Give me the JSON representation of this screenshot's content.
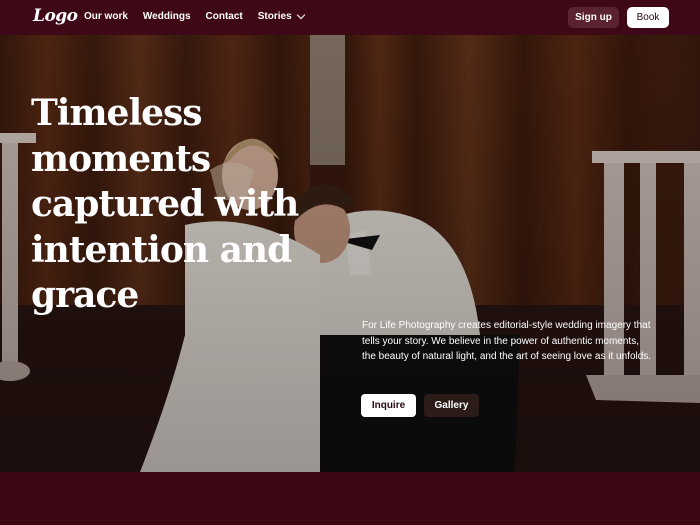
{
  "navbar": {
    "logo": "Logo",
    "links": [
      "Our work",
      "Weddings",
      "Contact",
      "Stories"
    ],
    "signup_label": "Sign up",
    "book_label": "Book"
  },
  "hero": {
    "title": "Timeless moments captured with intention and grace",
    "description": "For Life Photography creates editorial-style wedding imagery that tells your story. We believe in the power of authentic moments, the beauty of natural light, and the art of seeing love as it unfolds.",
    "inquire_label": "Inquire",
    "gallery_label": "Gallery"
  },
  "colors": {
    "brand_maroon": "#3b0713",
    "signup_bg": "#5b2230",
    "book_bg": "#ffffff",
    "gallery_bg": "#2b1c1a"
  },
  "icons": {
    "stories_dropdown": "chevron-down-icon"
  }
}
